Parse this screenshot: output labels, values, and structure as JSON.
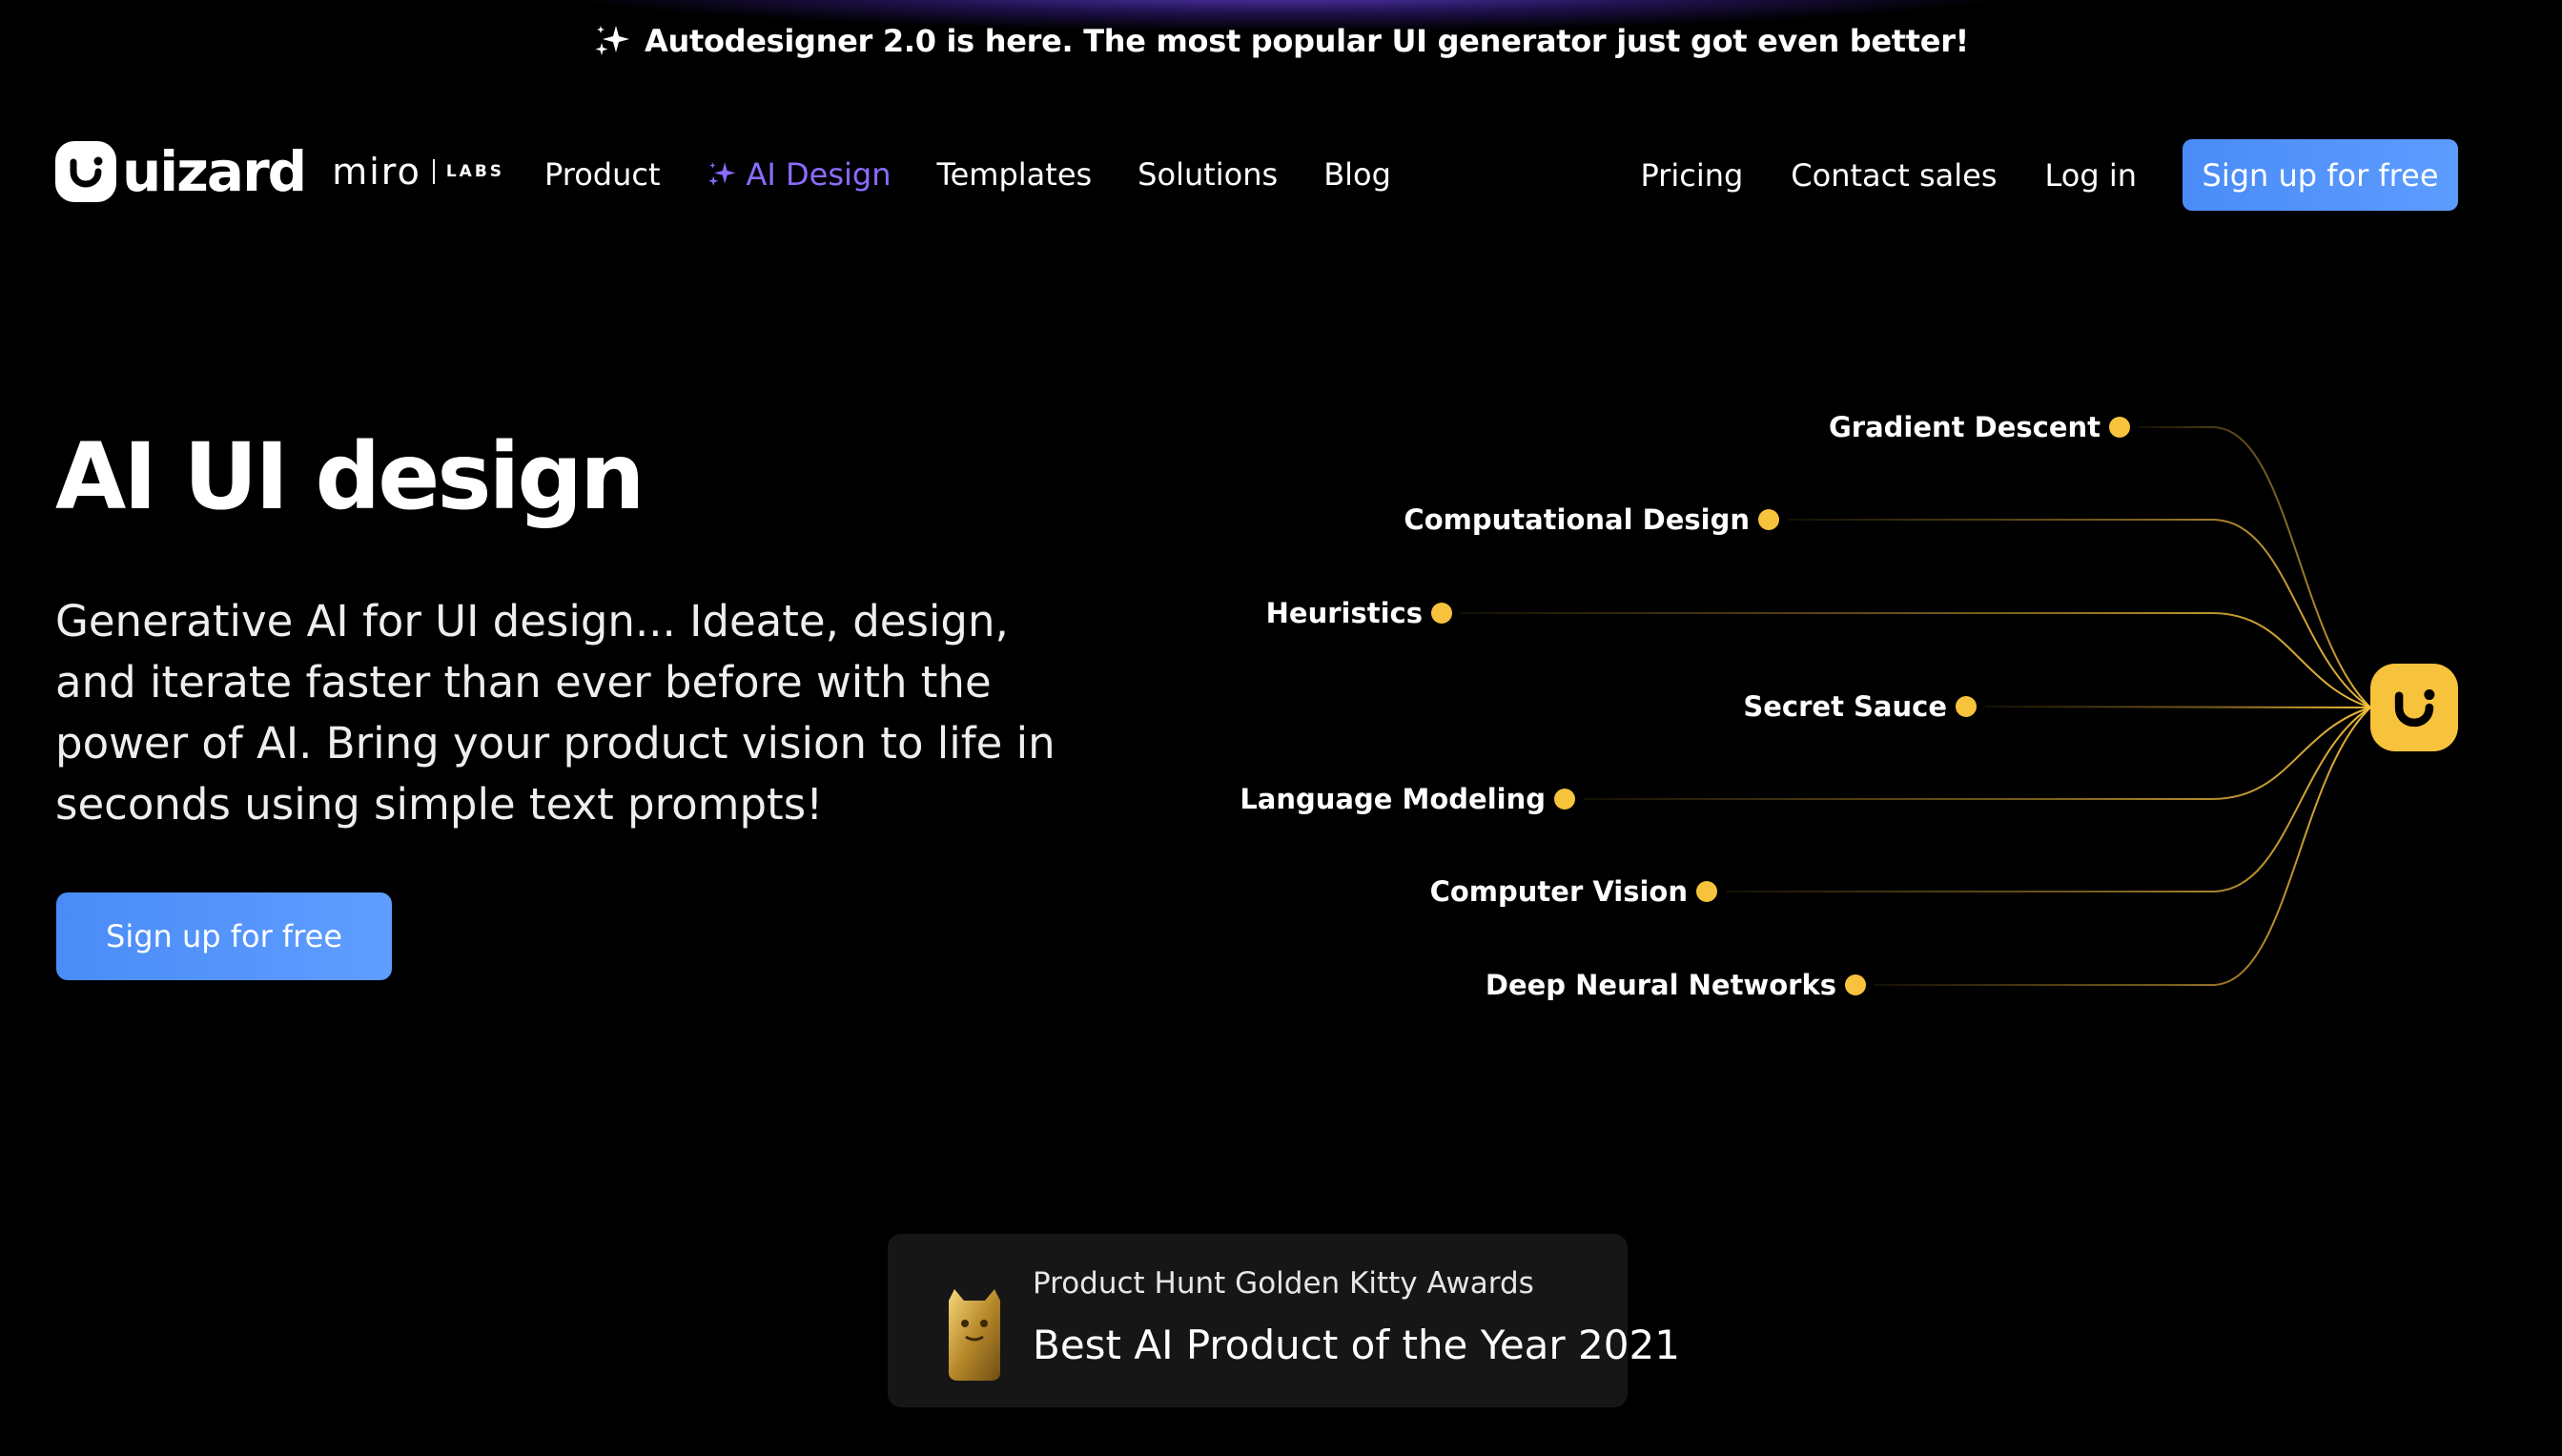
{
  "announcement": {
    "text": "Autodesigner 2.0 is here. The most popular UI generator just got even better!"
  },
  "brand": {
    "name": "uizard",
    "partner": "miro",
    "partner_suffix": "LABS"
  },
  "nav": {
    "items": [
      {
        "label": "Product"
      },
      {
        "label": "AI Design",
        "active": true
      },
      {
        "label": "Templates"
      },
      {
        "label": "Solutions"
      },
      {
        "label": "Blog"
      }
    ],
    "right": {
      "pricing": "Pricing",
      "contact": "Contact sales",
      "login": "Log in",
      "signup": "Sign up for free"
    }
  },
  "hero": {
    "title": "AI UI design",
    "subtitle": "Generative AI for UI design... Ideate, design, and iterate faster than ever before with the power of AI. Bring your product vision to life in seconds using simple text prompts!",
    "cta": "Sign up for free"
  },
  "diagram": {
    "nodes": [
      "Gradient Descent",
      "Computational Design",
      "Heuristics",
      "Secret Sauce",
      "Language Modeling",
      "Computer Vision",
      "Deep Neural Networks"
    ]
  },
  "award": {
    "event": "Product Hunt Golden Kitty Awards",
    "title": "Best AI Product of the Year 2021"
  },
  "colors": {
    "accent_blue": "#4a8cf7",
    "accent_purple": "#8b6cff",
    "node_yellow": "#f7c23c",
    "background": "#000000"
  }
}
